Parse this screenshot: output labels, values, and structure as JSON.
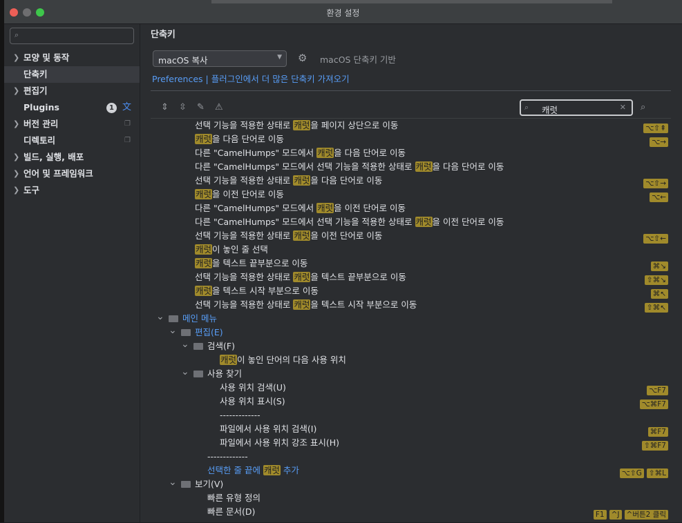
{
  "window": {
    "title": "환경 설정"
  },
  "sidebar": {
    "search_placeholder": "",
    "items": [
      {
        "label": "모양 및 동작",
        "expandable": true,
        "icon": "chevron-right-icon"
      },
      {
        "label": "단축키",
        "selected": true
      },
      {
        "label": "편집기",
        "expandable": true,
        "icon": "chevron-right-icon"
      },
      {
        "label": "Plugins",
        "badge": "1",
        "extra_icon": "translate-icon"
      },
      {
        "label": "버전 관리",
        "expandable": true,
        "extra_icon": "copy-icon"
      },
      {
        "label": "디렉토리",
        "extra_icon": "copy-icon"
      },
      {
        "label": "빌드, 실행, 배포",
        "expandable": true
      },
      {
        "label": "언어 및 프레임워크",
        "expandable": true
      },
      {
        "label": "도구",
        "expandable": true
      }
    ]
  },
  "main": {
    "title": "단축키",
    "keymap": {
      "selected": "macOS 복사",
      "based_on": "macOS 단축키 기반"
    },
    "links": {
      "preferences": "Preferences",
      "separator": "|",
      "plugins": "플러그인에서 더 많은 단축키 가져오기"
    },
    "toolbar": [
      "expand-all-icon",
      "collapse-all-icon",
      "edit-icon",
      "warning-icon"
    ],
    "search": {
      "value": "캐럿"
    }
  },
  "tree": [
    {
      "indent": 2,
      "parts": [
        "선택 기능을 적용한 상태로 ",
        {
          "hl": "캐럿"
        },
        "을 페이지 상단으로 이동"
      ],
      "keys": [
        "⌥⇧⇞"
      ]
    },
    {
      "indent": 2,
      "parts": [
        {
          "hl": "캐럿"
        },
        "을 다음 단어로 이동"
      ],
      "keys": [
        "⌥→"
      ]
    },
    {
      "indent": 2,
      "parts": [
        "다른 \"CamelHumps\" 모드에서 ",
        {
          "hl": "캐럿"
        },
        "을 다음 단어로 이동"
      ],
      "keys": []
    },
    {
      "indent": 2,
      "parts": [
        "다른 \"CamelHumps\" 모드에서 선택 기능을 적용한 상태로 ",
        {
          "hl": "캐럿"
        },
        "을 다음 단어로 이동"
      ],
      "keys": []
    },
    {
      "indent": 2,
      "parts": [
        "선택 기능을 적용한 상태로 ",
        {
          "hl": "캐럿"
        },
        "을 다음 단어로 이동"
      ],
      "keys": [
        "⌥⇧→"
      ]
    },
    {
      "indent": 2,
      "parts": [
        {
          "hl": "캐럿"
        },
        "을 이전 단어로 이동"
      ],
      "keys": [
        "⌥←"
      ]
    },
    {
      "indent": 2,
      "parts": [
        "다른 \"CamelHumps\" 모드에서 ",
        {
          "hl": "캐럿"
        },
        "을 이전 단어로 이동"
      ],
      "keys": []
    },
    {
      "indent": 2,
      "parts": [
        "다른 \"CamelHumps\" 모드에서 선택 기능을 적용한 상태로 ",
        {
          "hl": "캐럿"
        },
        "을 이전 단어로 이동"
      ],
      "keys": []
    },
    {
      "indent": 2,
      "parts": [
        "선택 기능을 적용한 상태로 ",
        {
          "hl": "캐럿"
        },
        "을 이전 단어로 이동"
      ],
      "keys": [
        "⌥⇧←"
      ]
    },
    {
      "indent": 2,
      "parts": [
        {
          "hl": "캐럿"
        },
        "이 놓인 줄 선택"
      ],
      "keys": []
    },
    {
      "indent": 2,
      "parts": [
        {
          "hl": "캐럿"
        },
        "을 텍스트 끝부분으로 이동"
      ],
      "keys": [
        "⌘↘"
      ]
    },
    {
      "indent": 2,
      "parts": [
        "선택 기능을 적용한 상태로 ",
        {
          "hl": "캐럿"
        },
        "을 텍스트 끝부분으로 이동"
      ],
      "keys": [
        "⇧⌘↘"
      ]
    },
    {
      "indent": 2,
      "parts": [
        {
          "hl": "캐럿"
        },
        "을 텍스트 시작 부분으로 이동"
      ],
      "keys": [
        "⌘↖"
      ]
    },
    {
      "indent": 2,
      "parts": [
        "선택 기능을 적용한 상태로 ",
        {
          "hl": "캐럿"
        },
        "을 텍스트 시작 부분으로 이동"
      ],
      "keys": [
        "⇧⌘↖"
      ]
    },
    {
      "indent": 0,
      "expander": "down",
      "folder": "menu",
      "blue": true,
      "parts": [
        "메인 메뉴"
      ],
      "keys": []
    },
    {
      "indent": 1,
      "expander": "down",
      "folder": "folder",
      "blue": true,
      "parts": [
        "편집(E)"
      ],
      "keys": []
    },
    {
      "indent": 2,
      "expander": "down",
      "folder": "folder",
      "parts": [
        "검색(F)"
      ],
      "keys": []
    },
    {
      "indent": 3,
      "parts": [
        {
          "hl": "캐럿"
        },
        "이 놓인 단어의 다음 사용 위치"
      ],
      "keys": []
    },
    {
      "indent": 2,
      "expander": "down",
      "folder": "folder",
      "parts": [
        "사용 찾기"
      ],
      "keys": []
    },
    {
      "indent": 3,
      "parts": [
        "사용 위치 검색(U)"
      ],
      "keys": [
        "⌥F7"
      ]
    },
    {
      "indent": 3,
      "parts": [
        "사용 위치 표시(S)"
      ],
      "keys": [
        "⌥⌘F7"
      ]
    },
    {
      "indent": 3,
      "parts": [
        "-------------"
      ],
      "keys": []
    },
    {
      "indent": 3,
      "parts": [
        "파일에서 사용 위치 검색(I)"
      ],
      "keys": [
        "⌘F7"
      ]
    },
    {
      "indent": 3,
      "parts": [
        "파일에서 사용 위치 강조 표시(H)"
      ],
      "keys": [
        "⇧⌘F7"
      ]
    },
    {
      "indent": 2,
      "parts": [
        "-------------"
      ],
      "keys": []
    },
    {
      "indent": 2,
      "blue": true,
      "parts": [
        "선택한 줄 끝에 ",
        {
          "hl": "캐럿"
        },
        " 추가"
      ],
      "keys": [
        "⌥⇧G",
        "⇧⌘L"
      ]
    },
    {
      "indent": 1,
      "expander": "down",
      "folder": "folder",
      "parts": [
        "보기(V)"
      ],
      "keys": []
    },
    {
      "indent": 2,
      "parts": [
        "빠른 유형 정의"
      ],
      "keys": []
    },
    {
      "indent": 2,
      "parts": [
        "빠른 문서(D)"
      ],
      "keys": [
        "F1",
        "^J",
        "^버튼2 클릭"
      ]
    }
  ]
}
